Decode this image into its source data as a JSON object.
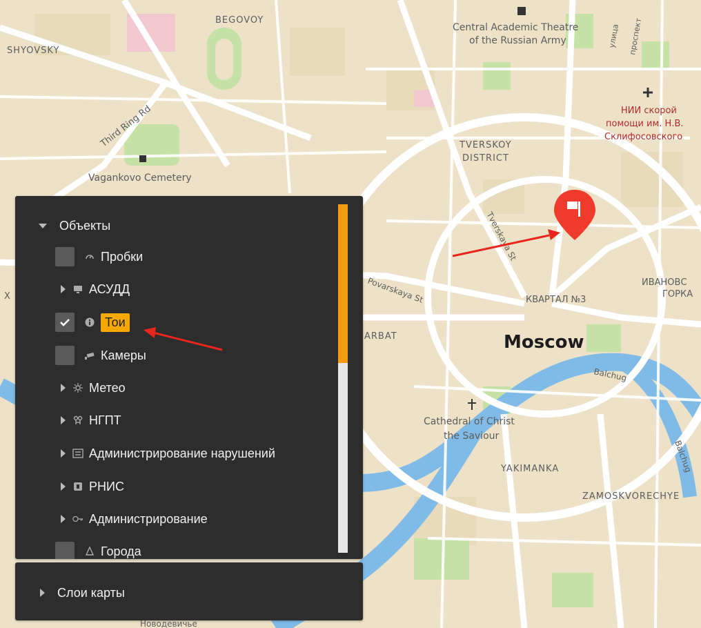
{
  "map": {
    "labels": {
      "begovoy": "BEGOVOY",
      "shyovsky": "SHYOVSKY",
      "third_ring": "Third Ring Rd",
      "vagankovo": "Vagankovo Cemetery",
      "theatre_1": "Central Academic Theatre",
      "theatre_2": "of the Russian Army",
      "ulitsa": "улица",
      "prospekt": "проспект",
      "nii_1": "НИИ скорой",
      "nii_2": "помощи им. Н.В.",
      "nii_3": "Склифосовского",
      "tverskoy_1": "TVERSKOY",
      "tverskoy_2": "DISTRICT",
      "tverskaya": "Tverskaya St",
      "povarskaya": "Povarskaya St",
      "kvartal": "КВАРТАЛ №3",
      "ivanovs_1": "ИВАНОВС",
      "ivanovs_2": "ГОРКА",
      "arbat": "ARBAT",
      "moscow": "Moscow",
      "balchug_1": "Balchug",
      "balchug_2": "Balchug",
      "cathedral_1": "Cathedral of Christ",
      "cathedral_2": "the Saviour",
      "yakimanka": "YAKIMANKA",
      "zamoskvorechye": "ZAMOSKVORECHYE",
      "novodevichye": "Новодевичье",
      "x_cut": "X"
    },
    "colors": {
      "land": "#ede2c8",
      "road": "#ffffff",
      "water": "#7fbbe6",
      "park": "#c5e1a5",
      "marker": "#ef3b2c",
      "arrow": "#e8261d"
    }
  },
  "layers": {
    "header": "Объекты",
    "items": [
      {
        "label": "Пробки",
        "icon": "speedometer-icon",
        "checked": false
      },
      {
        "label": "АСУДД",
        "icon": "monitor-icon",
        "expandable": true
      },
      {
        "label": "Тои",
        "icon": "info-icon",
        "checked": true,
        "highlighted": true
      },
      {
        "label": "Камеры",
        "icon": "camera-icon",
        "checked": false
      },
      {
        "label": "Метео",
        "icon": "weather-icon",
        "expandable": true
      },
      {
        "label": "НГПТ",
        "icon": "bus-stop-icon",
        "expandable": true
      },
      {
        "label": "Администрирование нарушений",
        "icon": "document-icon",
        "expandable": true
      },
      {
        "label": "РНИС",
        "icon": "square-icon",
        "expandable": true
      },
      {
        "label": "Администрирование",
        "icon": "key-icon",
        "expandable": true
      },
      {
        "label": "Города",
        "icon": "city-icon",
        "checked": false
      }
    ]
  },
  "map_layers": {
    "label": "Слои карты"
  },
  "scroll": {
    "position": 0
  }
}
